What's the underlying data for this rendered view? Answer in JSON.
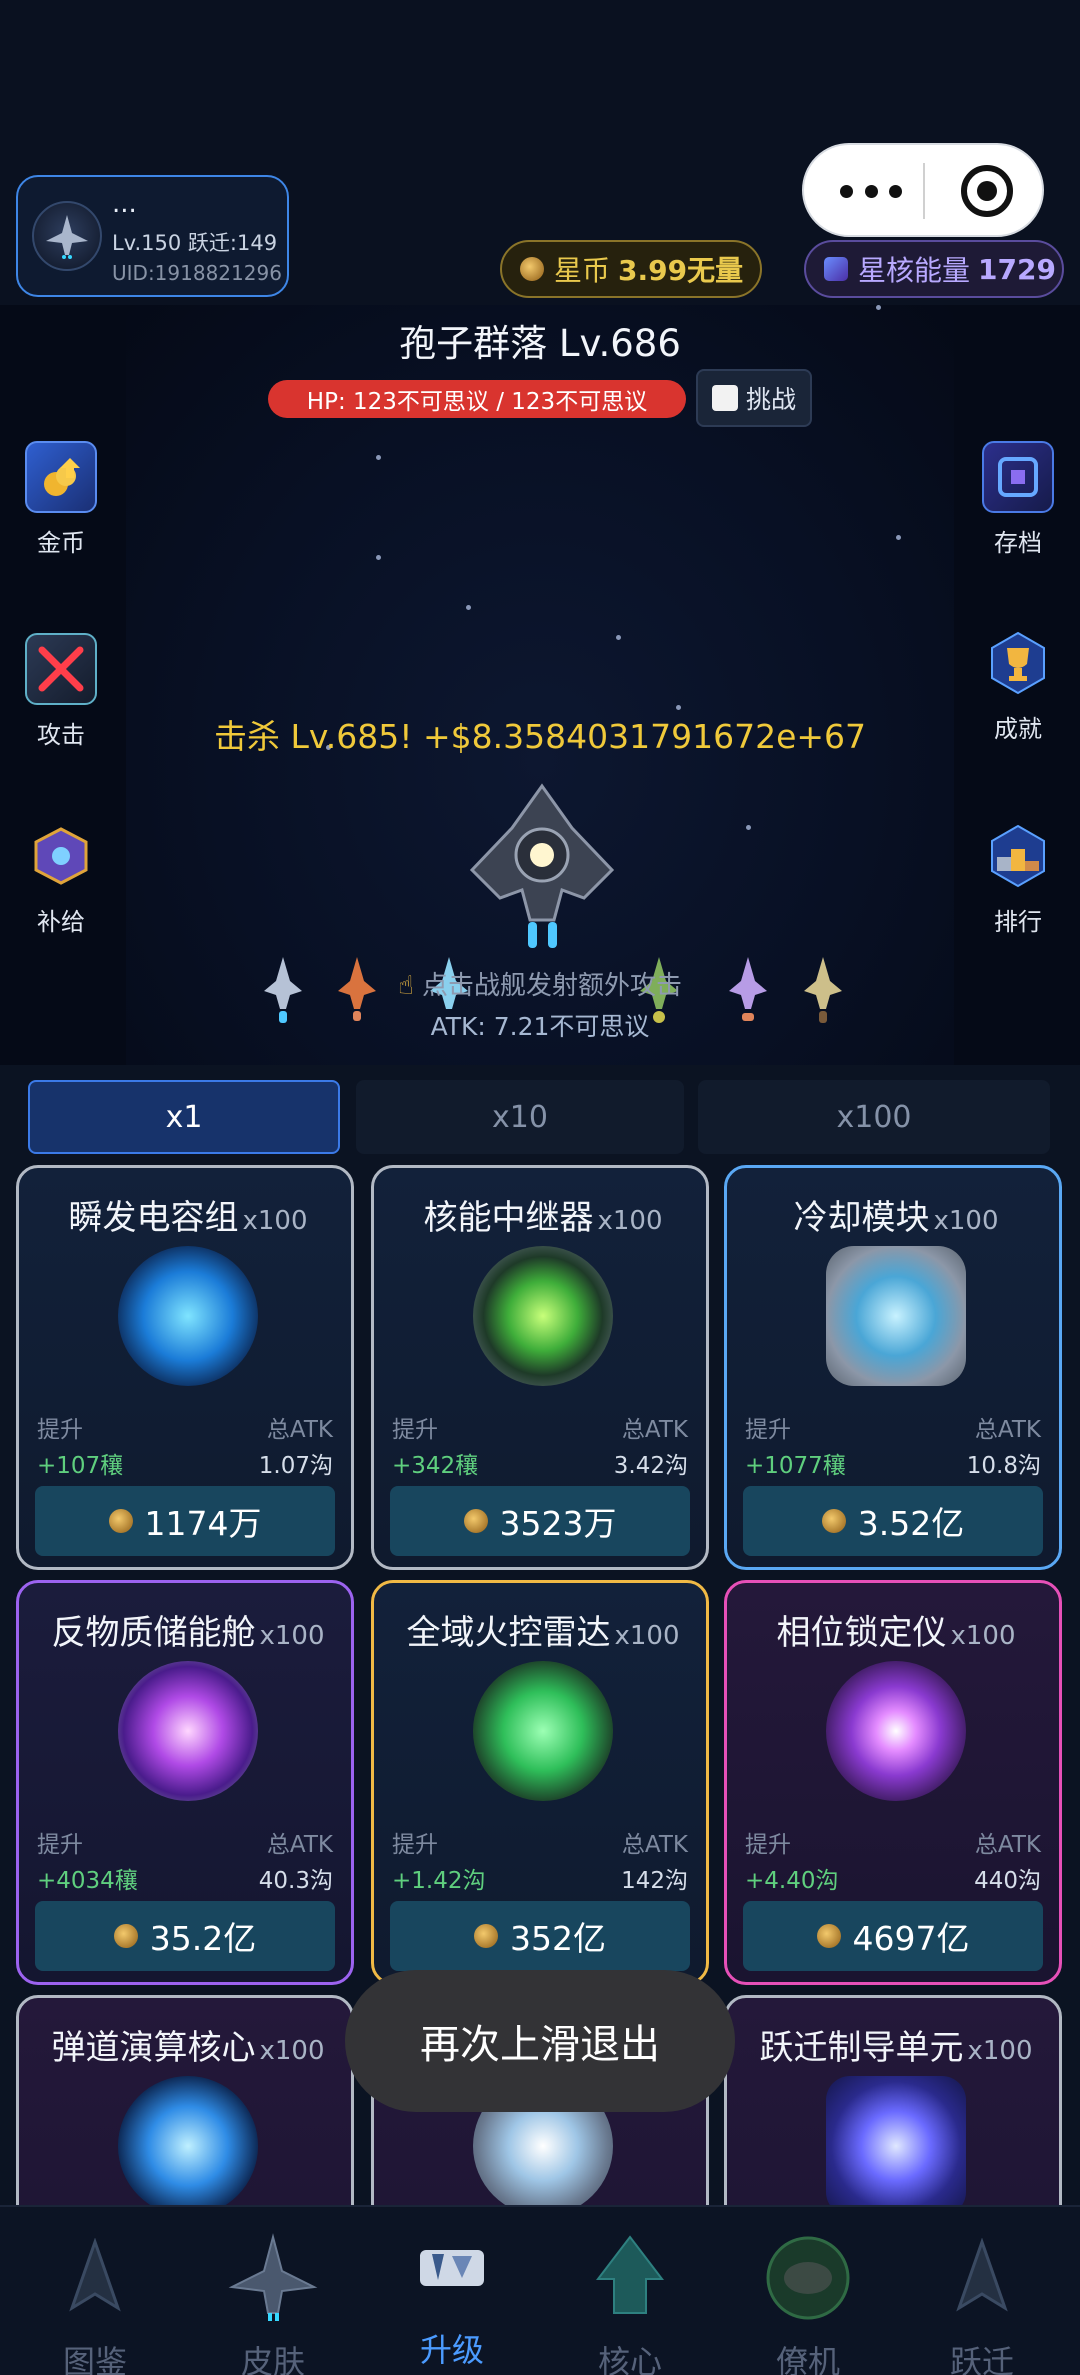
{
  "header": {
    "player_name": "...",
    "player_level": "Lv.150 跃迁:149",
    "player_uid": "UID:1918821296",
    "coin_label": "星币",
    "coin_value": "3.99无量",
    "energy_label": "星核能量",
    "energy_value": "1729"
  },
  "battle": {
    "boss_title": "孢子群落 Lv.686",
    "hp_text": "HP: 123不可思议 / 123不可思议",
    "challenge_label": "挑战",
    "kill_text": "击杀 Lv.685! +$8.3584031791672e+67",
    "hint_text": "点击战舰发射额外攻击",
    "atk_text": "ATK: 7.21不可思议",
    "side_left": [
      {
        "label": "金币",
        "icon": "gold-coins-icon"
      },
      {
        "label": "攻击",
        "icon": "crossed-swords-icon"
      },
      {
        "label": "补给",
        "icon": "supply-crate-icon"
      }
    ],
    "side_right": [
      {
        "label": "存档",
        "icon": "save-icon"
      },
      {
        "label": "成就",
        "icon": "trophy-icon"
      },
      {
        "label": "排行",
        "icon": "podium-icon"
      }
    ]
  },
  "multipliers": [
    "x1",
    "x10",
    "x100"
  ],
  "cards": [
    {
      "name": "瞬发电容组",
      "mult": "x100",
      "lift_label": "提升",
      "lift": "+107穰",
      "atk_label": "总ATK",
      "atk": "1.07沟",
      "cost": "1174万",
      "border": "#b2b9c4"
    },
    {
      "name": "核能中继器",
      "mult": "x100",
      "lift_label": "提升",
      "lift": "+342穰",
      "atk_label": "总ATK",
      "atk": "3.42沟",
      "cost": "3523万",
      "border": "#b2b9c4"
    },
    {
      "name": "冷却模块",
      "mult": "x100",
      "lift_label": "提升",
      "lift": "+1077穰",
      "atk_label": "总ATK",
      "atk": "10.8沟",
      "cost": "3.52亿",
      "border": "#5aa8f4"
    },
    {
      "name": "反物质储能舱",
      "mult": "x100",
      "lift_label": "提升",
      "lift": "+4034穰",
      "atk_label": "总ATK",
      "atk": "40.3沟",
      "cost": "35.2亿",
      "border": "#9c63f0"
    },
    {
      "name": "全域火控雷达",
      "mult": "x100",
      "lift_label": "提升",
      "lift": "+1.42沟",
      "atk_label": "总ATK",
      "atk": "142沟",
      "cost": "352亿",
      "border": "#f0b945"
    },
    {
      "name": "相位锁定仪",
      "mult": "x100",
      "lift_label": "提升",
      "lift": "+4.40沟",
      "atk_label": "总ATK",
      "atk": "440沟",
      "cost": "4697亿",
      "border": "#e650b8"
    },
    {
      "name": "弹道演算核心",
      "mult": "x100"
    },
    {
      "name": "",
      "mult": ""
    },
    {
      "name": "跃迁制导单元",
      "mult": "x100"
    }
  ],
  "toast": "再次上滑退出",
  "nav": [
    {
      "label": "图鉴",
      "icon": "codex-icon"
    },
    {
      "label": "皮肤",
      "icon": "ship-skin-icon"
    },
    {
      "label": "升级",
      "icon": "upgrade-icon"
    },
    {
      "label": "核心",
      "icon": "core-icon"
    },
    {
      "label": "僚机",
      "icon": "wingman-icon"
    },
    {
      "label": "跃迁",
      "icon": "warp-icon"
    }
  ],
  "colors": {
    "accent": "#3b7ae8",
    "coin": "#e9c94d",
    "energy": "#b8a9ff",
    "hp": "#d9342f",
    "gain": "#5fcf7e"
  }
}
